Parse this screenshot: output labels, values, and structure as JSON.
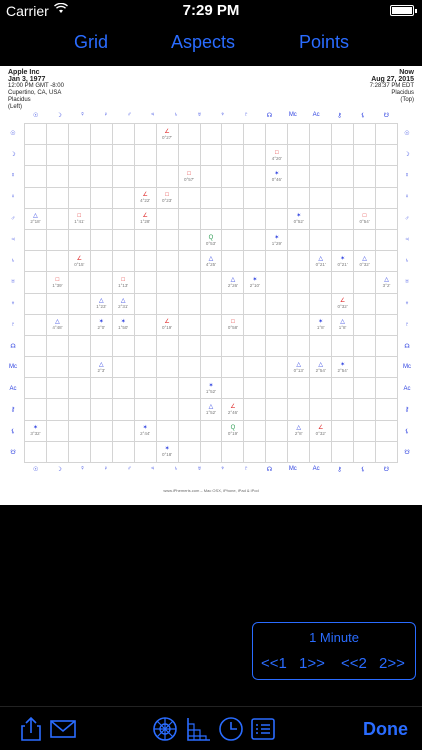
{
  "status": {
    "carrier": "Carrier",
    "time": "7:29 PM"
  },
  "tabs": {
    "grid": "Grid",
    "aspects": "Aspects",
    "points": "Points"
  },
  "chart_left": {
    "name": "Apple Inc",
    "date": "Jan 3, 1977",
    "time": "12:00 PM GMT -8:00",
    "place": "Cupertino, CA, USA",
    "house": "Placidus",
    "tag": "(Left)"
  },
  "chart_right": {
    "name": "Now",
    "date": "Aug 27, 2015",
    "time": "7:28:37 PM EDT",
    "house": "Placidus",
    "tag": "(Top)"
  },
  "planet_glyphs": [
    "☉",
    "☽",
    "☿",
    "♀",
    "♂",
    "♃",
    "♄",
    "♅",
    "♆",
    "♇",
    "☊",
    "Mc",
    "Ac",
    "⚷",
    "⚸",
    "☋"
  ],
  "grid_cells": [
    {
      "r": 0,
      "c": 6,
      "sym": "∠",
      "val": "0°27'",
      "col": "red"
    },
    {
      "r": 1,
      "c": 11,
      "sym": "□",
      "val": "4°20'",
      "col": "red"
    },
    {
      "r": 2,
      "c": 7,
      "sym": "□",
      "val": "0°57'",
      "col": "red"
    },
    {
      "r": 2,
      "c": 11,
      "sym": "✶",
      "val": "0°46'",
      "col": "blue"
    },
    {
      "r": 3,
      "c": 5,
      "sym": "∠",
      "val": "4°22'",
      "col": "red"
    },
    {
      "r": 3,
      "c": 6,
      "sym": "□",
      "val": "0°23'",
      "col": "red"
    },
    {
      "r": 4,
      "c": 0,
      "sym": "△",
      "val": "2°18'",
      "col": "blue"
    },
    {
      "r": 4,
      "c": 2,
      "sym": "□",
      "val": "1°41'",
      "col": "red"
    },
    {
      "r": 4,
      "c": 5,
      "sym": "∠",
      "val": "1°28'",
      "col": "red"
    },
    {
      "r": 4,
      "c": 12,
      "sym": "✶",
      "val": "0°52'",
      "col": "blue"
    },
    {
      "r": 4,
      "c": 15,
      "sym": "□",
      "val": "0°54'",
      "col": "red"
    },
    {
      "r": 5,
      "c": 8,
      "sym": "Q",
      "val": "0°53'",
      "col": "green"
    },
    {
      "r": 5,
      "c": 11,
      "sym": "✶",
      "val": "1°29'",
      "col": "blue"
    },
    {
      "r": 6,
      "c": 2,
      "sym": "∠",
      "val": "0°15'",
      "col": "red"
    },
    {
      "r": 6,
      "c": 8,
      "sym": "△",
      "val": "4°25'",
      "col": "blue"
    },
    {
      "r": 6,
      "c": 13,
      "sym": "△",
      "val": "0°21'",
      "col": "blue"
    },
    {
      "r": 6,
      "c": 14,
      "sym": "✶",
      "val": "0°21'",
      "col": "blue"
    },
    {
      "r": 6,
      "c": 15,
      "sym": "△",
      "val": "0°32'",
      "col": "blue"
    },
    {
      "r": 7,
      "c": 1,
      "sym": "□",
      "val": "1°39'",
      "col": "red"
    },
    {
      "r": 7,
      "c": 4,
      "sym": "□",
      "val": "1°13'",
      "col": "red"
    },
    {
      "r": 7,
      "c": 9,
      "sym": "△",
      "val": "2°26'",
      "col": "blue"
    },
    {
      "r": 7,
      "c": 10,
      "sym": "✶",
      "val": "2°10'",
      "col": "blue"
    },
    {
      "r": 7,
      "c": 16,
      "sym": "△",
      "val": "3°2'",
      "col": "blue"
    },
    {
      "r": 8,
      "c": 3,
      "sym": "△",
      "val": "1°23'",
      "col": "blue"
    },
    {
      "r": 8,
      "c": 4,
      "sym": "△",
      "val": "2°31'",
      "col": "blue"
    },
    {
      "r": 8,
      "c": 14,
      "sym": "∠",
      "val": "0°32'",
      "col": "red"
    },
    {
      "r": 9,
      "c": 1,
      "sym": "△",
      "val": "4°48'",
      "col": "blue"
    },
    {
      "r": 9,
      "c": 3,
      "sym": "✶",
      "val": "2°0'",
      "col": "blue"
    },
    {
      "r": 9,
      "c": 4,
      "sym": "✶",
      "val": "1°50'",
      "col": "blue"
    },
    {
      "r": 9,
      "c": 6,
      "sym": "∠",
      "val": "0°19'",
      "col": "red"
    },
    {
      "r": 9,
      "c": 9,
      "sym": "□",
      "val": "0°58'",
      "col": "red"
    },
    {
      "r": 9,
      "c": 13,
      "sym": "✶",
      "val": "1°8'",
      "col": "blue"
    },
    {
      "r": 9,
      "c": 14,
      "sym": "△",
      "val": "1°8'",
      "col": "blue"
    },
    {
      "r": 11,
      "c": 3,
      "sym": "△",
      "val": "2°3'",
      "col": "blue"
    },
    {
      "r": 11,
      "c": 12,
      "sym": "△",
      "val": "0°13'",
      "col": "blue"
    },
    {
      "r": 11,
      "c": 13,
      "sym": "△",
      "val": "2°54'",
      "col": "blue"
    },
    {
      "r": 11,
      "c": 14,
      "sym": "✶",
      "val": "2°54'",
      "col": "blue"
    },
    {
      "r": 12,
      "c": 8,
      "sym": "✶",
      "val": "1°52'",
      "col": "blue"
    },
    {
      "r": 13,
      "c": 8,
      "sym": "△",
      "val": "1°52'",
      "col": "blue"
    },
    {
      "r": 13,
      "c": 9,
      "sym": "∠",
      "val": "2°46'",
      "col": "red"
    },
    {
      "r": 14,
      "c": 0,
      "sym": "✶",
      "val": "3°32'",
      "col": "blue"
    },
    {
      "r": 14,
      "c": 5,
      "sym": "✶",
      "val": "2°44'",
      "col": "blue"
    },
    {
      "r": 14,
      "c": 9,
      "sym": "Q",
      "val": "0°19'",
      "col": "green"
    },
    {
      "r": 14,
      "c": 12,
      "sym": "△",
      "val": "2°8'",
      "col": "blue"
    },
    {
      "r": 14,
      "c": 13,
      "sym": "∠",
      "val": "0°32'",
      "col": "red"
    },
    {
      "r": 15,
      "c": 6,
      "sym": "✶",
      "val": "0°18'",
      "col": "blue"
    }
  ],
  "footer": "www.iPhemeris.com – Mac OSX, iPhone, iPad & iPod",
  "time_panel": {
    "title": "1 Minute",
    "back1": "<<1",
    "fwd1": "1>>",
    "back2": "<<2",
    "fwd2": "2>>"
  },
  "toolbar": {
    "done": "Done"
  },
  "colors": {
    "accent": "#2a6cff",
    "aspect_red": "#e03030",
    "aspect_blue": "#2a3ee0",
    "aspect_green": "#2a9a50"
  }
}
